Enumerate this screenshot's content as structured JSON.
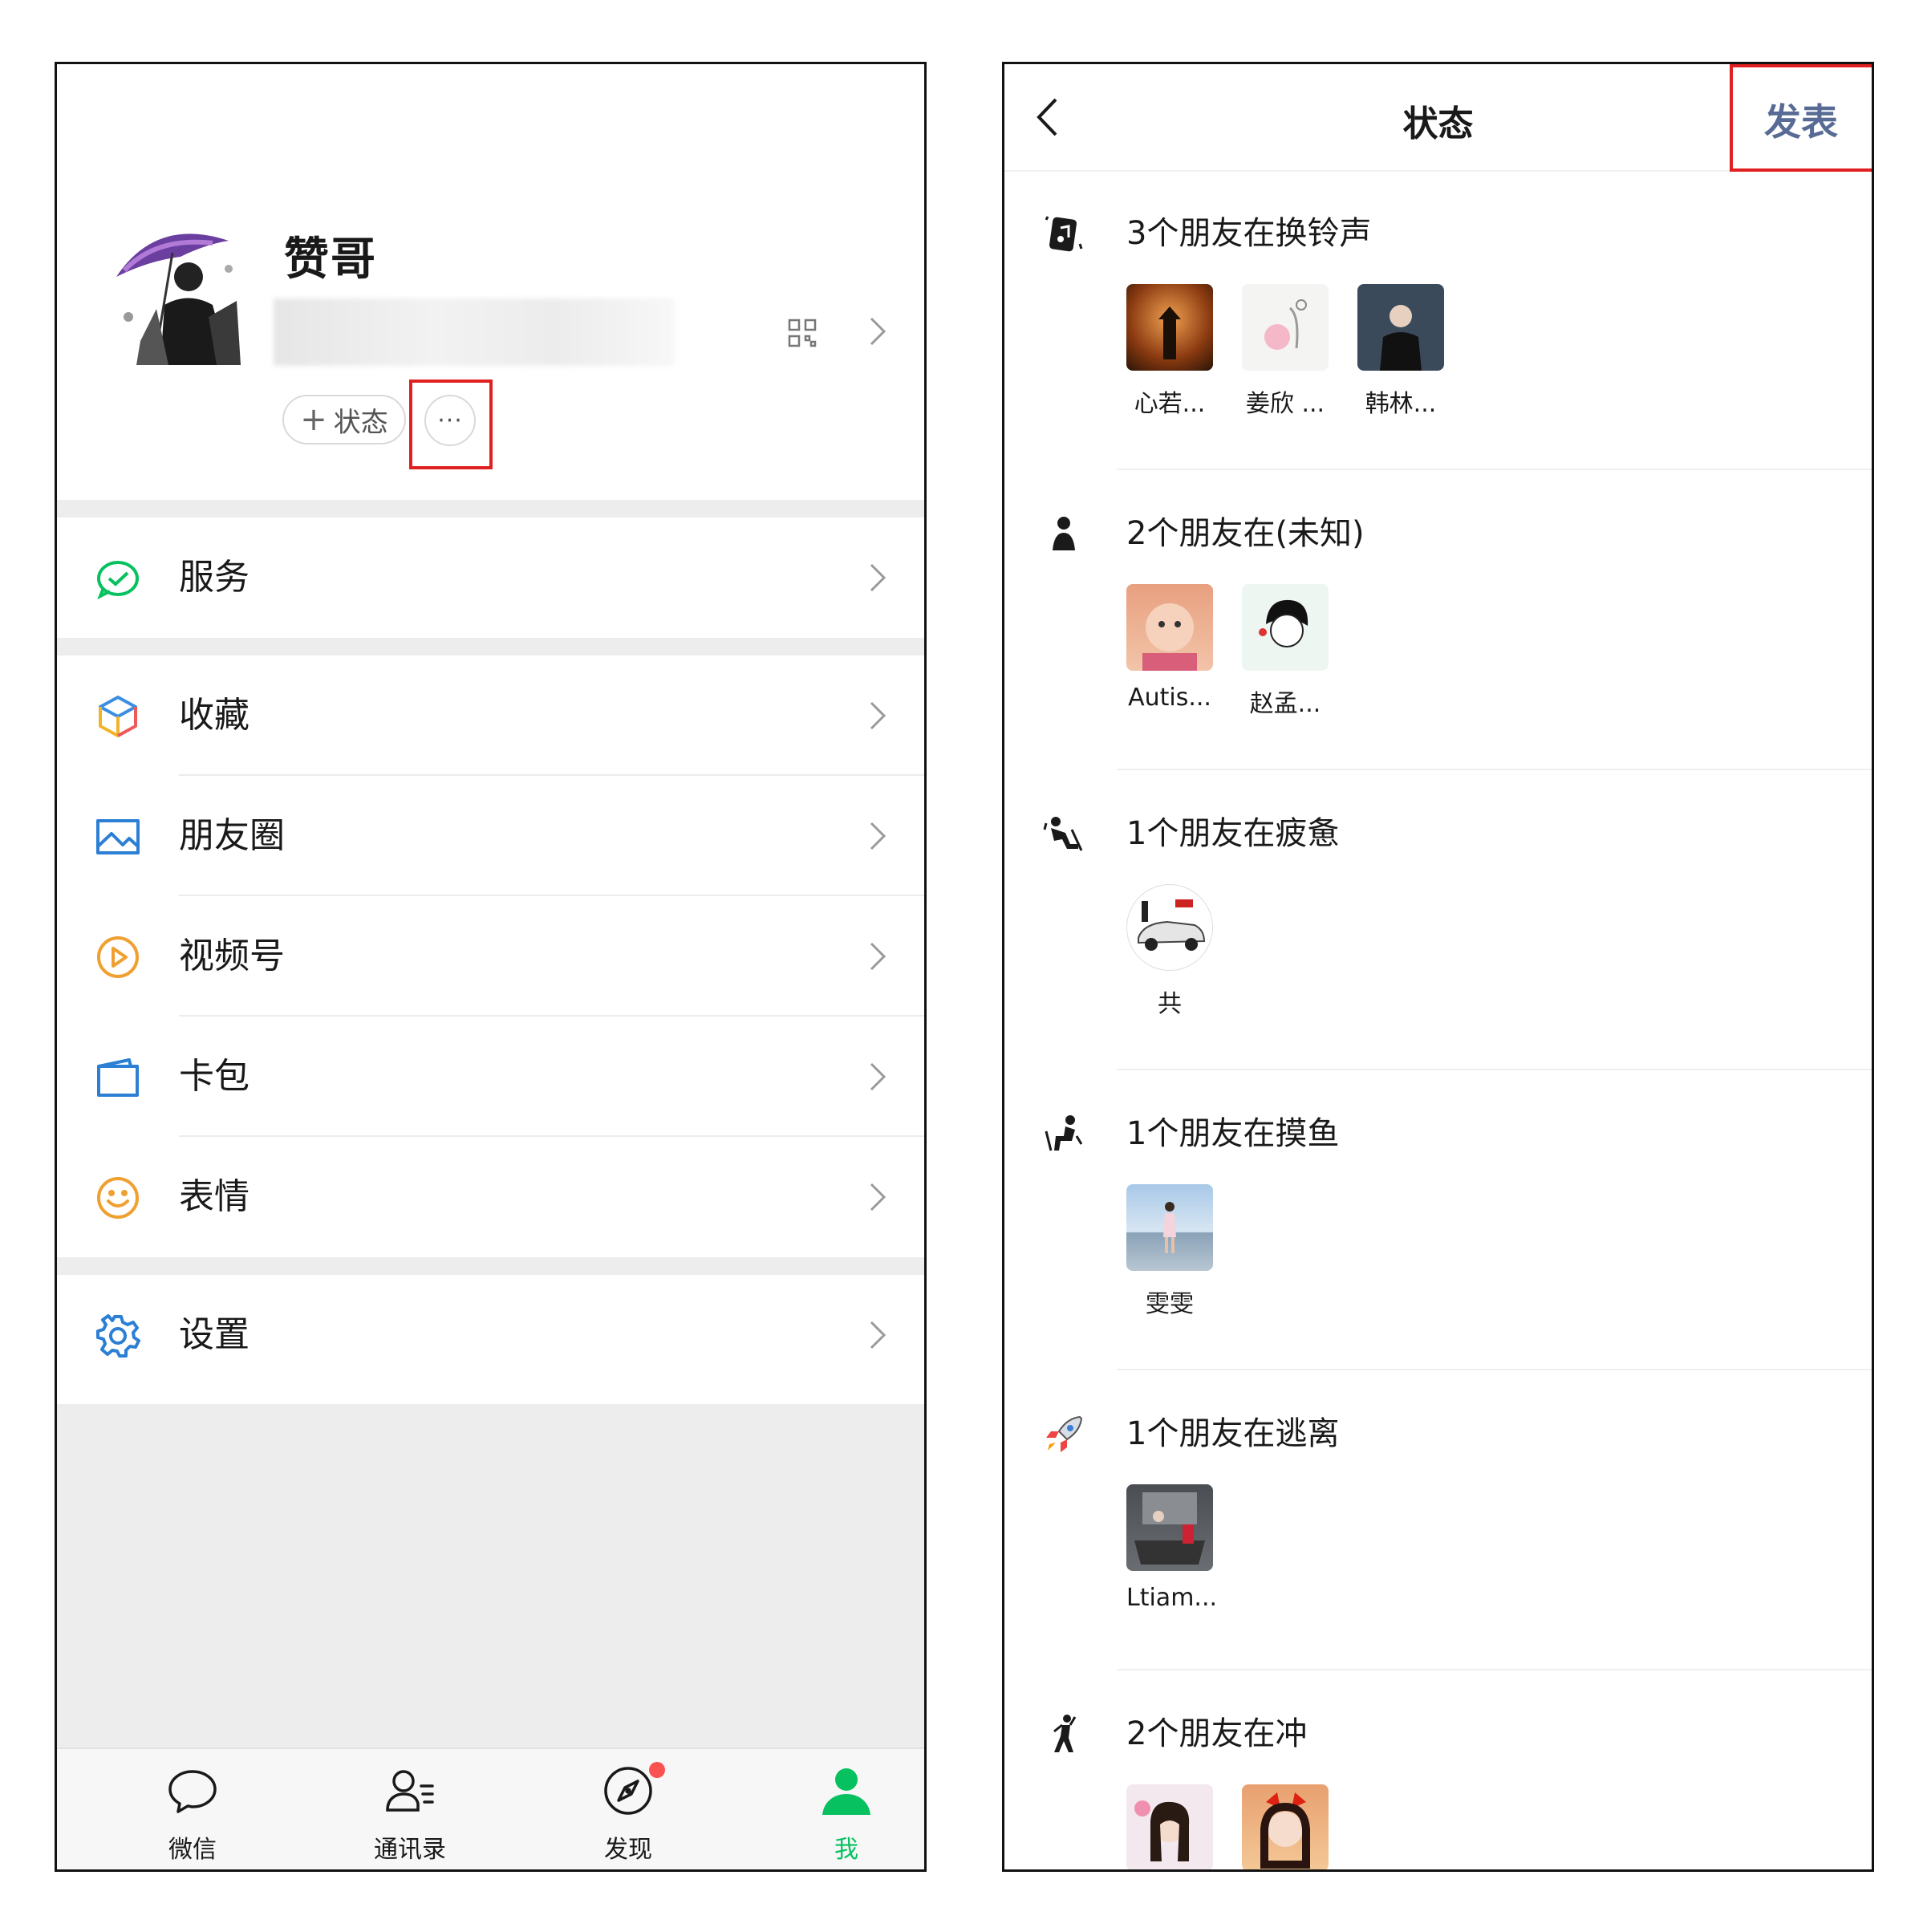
{
  "left": {
    "profile": {
      "nickname": "赞哥",
      "status_button_label": "状态",
      "status_plus": "+",
      "more_label": "···"
    },
    "menu": [
      {
        "label": "服务",
        "icon": "service-icon",
        "color": "#07c160"
      },
      {
        "label": "收藏",
        "icon": "favorites-cube-icon",
        "color": "#f0b429"
      },
      {
        "label": "朋友圈",
        "icon": "moments-image-icon",
        "color": "#2b7fd4"
      },
      {
        "label": "视频号",
        "icon": "channels-play-icon",
        "color": "#f0a030"
      },
      {
        "label": "卡包",
        "icon": "card-wallet-icon",
        "color": "#2b7fd4"
      },
      {
        "label": "表情",
        "icon": "sticker-smile-icon",
        "color": "#f0a030"
      },
      {
        "label": "设置",
        "icon": "settings-gear-icon",
        "color": "#2b7fd4"
      }
    ],
    "tabs": [
      {
        "label": "微信",
        "icon": "chat-bubble-icon"
      },
      {
        "label": "通讯录",
        "icon": "contacts-icon"
      },
      {
        "label": "发现",
        "icon": "compass-icon",
        "badge": "red-dot"
      },
      {
        "label": "我",
        "icon": "me-person-icon",
        "active": true
      }
    ],
    "accent_color": "#07c160",
    "highlight_color": "#e02020"
  },
  "right": {
    "header": {
      "title": "状态",
      "publish_label": "发表",
      "publish_color": "#576b95"
    },
    "groups": [
      {
        "title": "3个朋友在换铃声",
        "icon": "ringtone-music-icon",
        "friends": [
          "心若...",
          "姜欣 ...",
          "韩林..."
        ]
      },
      {
        "title": "2个朋友在(未知)",
        "icon": "unknown-person-icon",
        "friends": [
          "Autis...",
          "赵孟..."
        ]
      },
      {
        "title": "1个朋友在疲惫",
        "icon": "tired-person-icon",
        "friends": [
          "共"
        ]
      },
      {
        "title": "1个朋友在摸鱼",
        "icon": "slacking-person-icon",
        "friends": [
          "雯雯"
        ]
      },
      {
        "title": "1个朋友在逃离",
        "icon": "rocket-icon",
        "friends": [
          "Ltiam..."
        ]
      },
      {
        "title": "2个朋友在冲",
        "icon": "running-person-icon",
        "friends": [
          "",
          ""
        ]
      }
    ]
  }
}
